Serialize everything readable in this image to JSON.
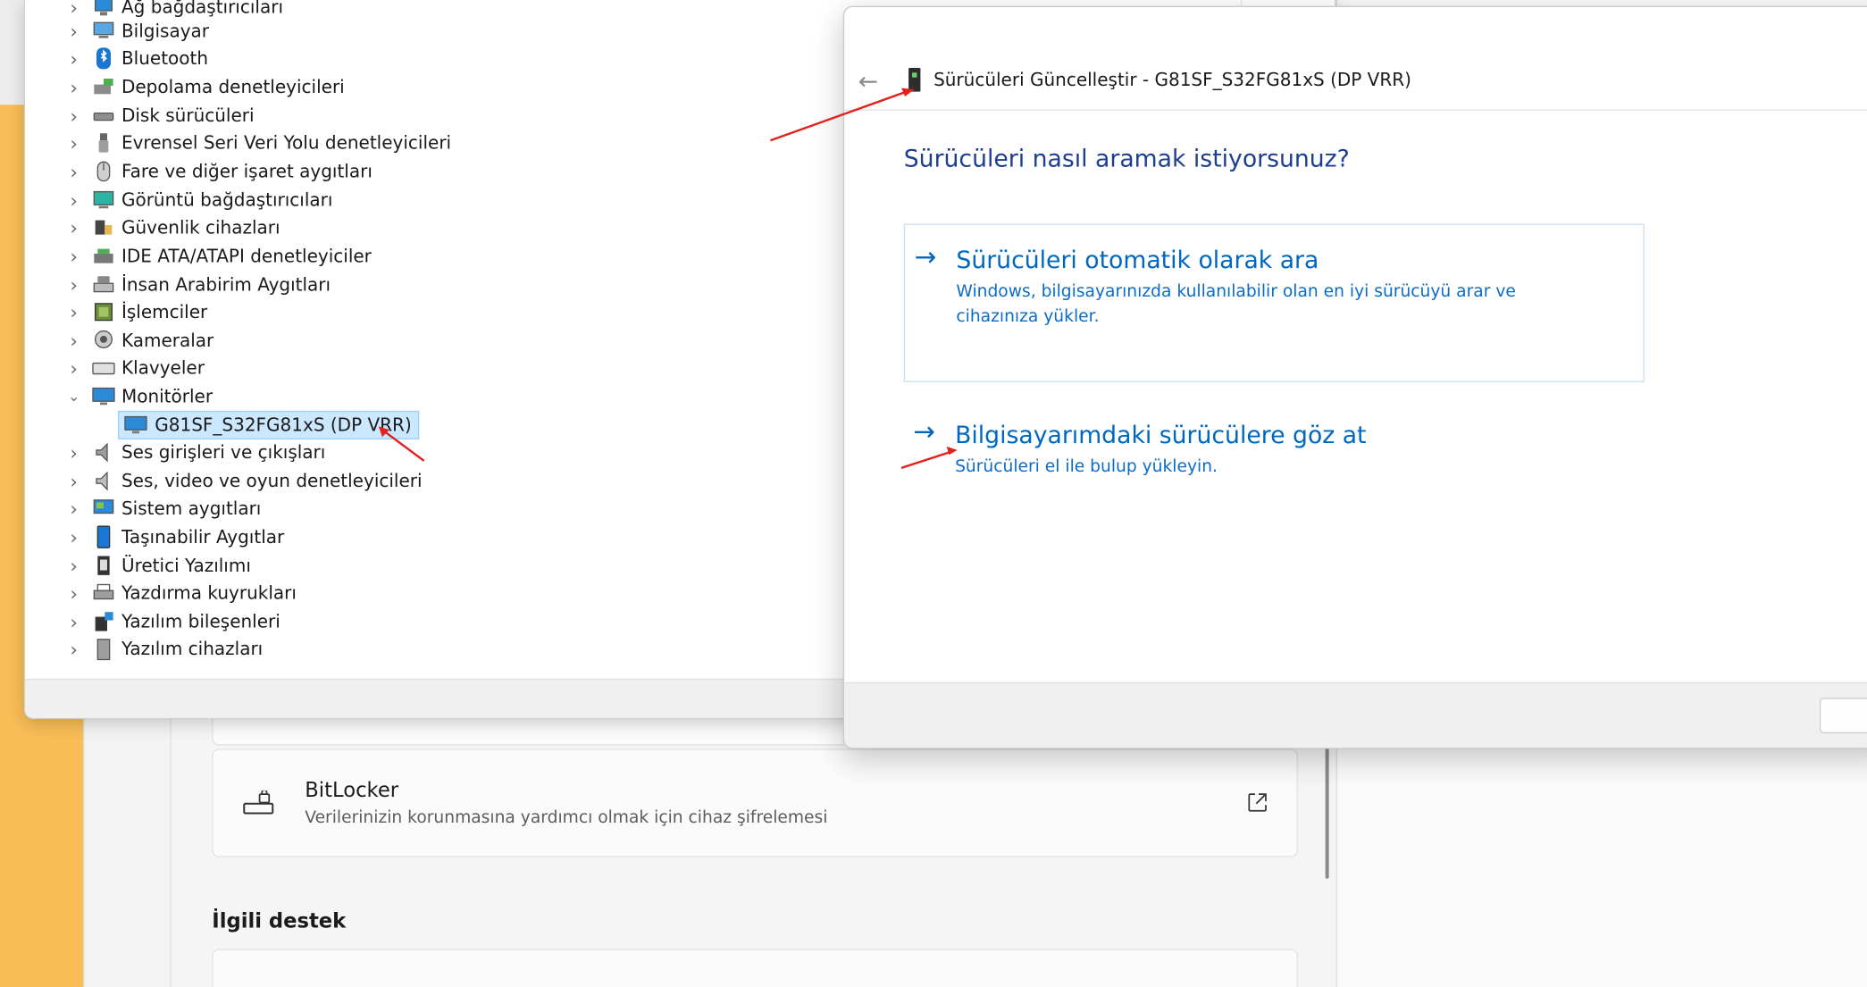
{
  "device_manager": {
    "categories": [
      {
        "label": "Ağ bağdaştırıcıları",
        "icon": "network-adapter-icon"
      },
      {
        "label": "Bilgisayar",
        "icon": "computer-icon"
      },
      {
        "label": "Bluetooth",
        "icon": "bluetooth-icon"
      },
      {
        "label": "Depolama denetleyicileri",
        "icon": "storage-controller-icon"
      },
      {
        "label": "Disk sürücüleri",
        "icon": "disk-drive-icon"
      },
      {
        "label": "Evrensel Seri Veri Yolu denetleyicileri",
        "icon": "usb-icon"
      },
      {
        "label": "Fare ve diğer işaret aygıtları",
        "icon": "mouse-icon"
      },
      {
        "label": "Görüntü bağdaştırıcıları",
        "icon": "display-adapter-icon"
      },
      {
        "label": "Güvenlik cihazları",
        "icon": "security-device-icon"
      },
      {
        "label": "IDE ATA/ATAPI denetleyiciler",
        "icon": "ide-controller-icon"
      },
      {
        "label": "İnsan Arabirim Aygıtları",
        "icon": "hid-icon"
      },
      {
        "label": "İşlemciler",
        "icon": "processor-icon"
      },
      {
        "label": "Kameralar",
        "icon": "camera-icon"
      },
      {
        "label": "Klavyeler",
        "icon": "keyboard-icon"
      },
      {
        "label": "Monitörler",
        "icon": "monitor-icon",
        "expanded": true
      },
      {
        "label": "Ses girişleri ve çıkışları",
        "icon": "speaker-icon"
      },
      {
        "label": "Ses, video ve oyun denetleyicileri",
        "icon": "sound-controller-icon"
      },
      {
        "label": "Sistem aygıtları",
        "icon": "system-device-icon"
      },
      {
        "label": "Taşınabilir Aygıtlar",
        "icon": "portable-device-icon"
      },
      {
        "label": "Üretici Yazılımı",
        "icon": "firmware-icon"
      },
      {
        "label": "Yazdırma kuyrukları",
        "icon": "printer-icon"
      },
      {
        "label": "Yazılım bileşenleri",
        "icon": "software-component-icon"
      },
      {
        "label": "Yazılım cihazları",
        "icon": "software-device-icon"
      }
    ],
    "selected_device": "G81SF_S32FG81xS (DP VRR)"
  },
  "update_dialog": {
    "title": "Sürücüleri Güncelleştir - G81SF_S32FG81xS (DP VRR)",
    "question": "Sürücüleri nasıl aramak istiyorsunuz?",
    "option_auto": {
      "title": "Sürücüleri otomatik olarak ara",
      "description": "Windows, bilgisayarınızda kullanılabilir olan en iyi sürücüyü arar ve cihazınıza yükler."
    },
    "option_browse": {
      "title": "Bilgisayarımdaki sürücülere göz at",
      "description": "Sürücüleri el ile bulup yükleyin."
    }
  },
  "settings": {
    "bitlocker_title": "BitLocker",
    "bitlocker_desc": "Verilerinizin korunmasına yardımcı olmak için cihaz şifrelemesi",
    "related_support_heading": "İlgili destek"
  },
  "colors": {
    "link_blue": "#0067c0",
    "heading_blue": "#1e3f8f",
    "selection_bg": "#cce8ff",
    "annotation_red": "#e3201b",
    "wallpaper": "#f9bd57"
  }
}
